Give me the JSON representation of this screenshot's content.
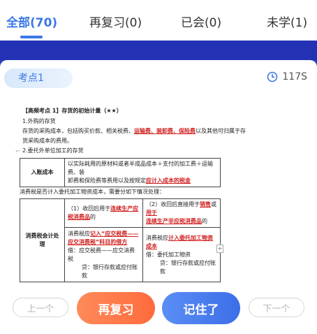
{
  "tabs": [
    {
      "label": "全部(70)",
      "active": true
    },
    {
      "label": "再复习(0)",
      "active": false
    },
    {
      "label": "已会(0)",
      "active": false
    },
    {
      "label": "未学(1)",
      "active": false
    }
  ],
  "card": {
    "badge": "考点1",
    "timer": "117S"
  },
  "note": {
    "title": "【高频考点 1】存货的初始计量（★★）",
    "line1": "1.外购的存货",
    "line2_a": "存货的采购成本，包括购买价款、相关税费、",
    "line2_b": "运输费、装卸费、保险费",
    "line2_c": "以及其他可归属于存",
    "line3": "货采购成本的费用。",
    "line4": "2.委托外单位加工的存货",
    "table1_header": "入账成本",
    "table1_a": "以实际耗用的原材料或者半成品成本＋支付的加工费＋运输费、装",
    "table1_b": "卸费和保险费等费用以及按规定",
    "table1_c": "应计入成本的税金",
    "line5": "消费税是否计入委托加工物资成本，需要分如下情况处理：",
    "table2_header": "消费税会计处理",
    "case1_a": "（1）收回后用于",
    "case1_b": "连续生产应",
    "case1_c": "税消费品",
    "case1_d": "的",
    "case2_a": "（2）收回后直接用于",
    "case2_b": "销售",
    "case2_c": "或",
    "case2_d": "用于",
    "case2_e": "连续生产非应税消费品",
    "case2_f": "的",
    "r1_a": "消费税应",
    "r1_b": "记入“应交税费——",
    "r1_c": "应交消费税”科目的借方",
    "r1_d": "借：应交税费——应交消费税",
    "r1_e": "贷：银行存款或应付账款",
    "r2_a": "消费税应",
    "r2_b": "计入委托加工物资成本",
    "r2_c": "借：委托加工物资",
    "r2_d": "贷：银行存款或应付账款"
  },
  "buttons": {
    "prev": "上一个",
    "review": "再复习",
    "remember": "记住了",
    "next": "下一个"
  }
}
